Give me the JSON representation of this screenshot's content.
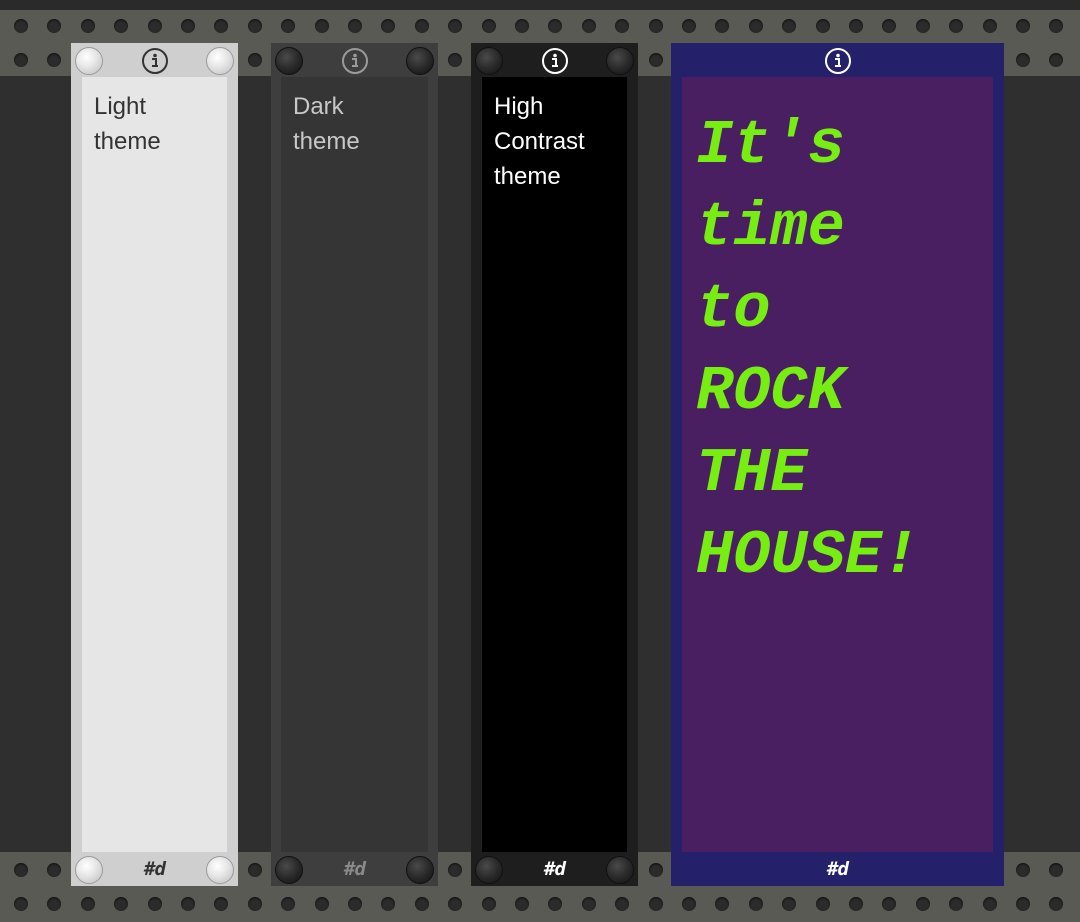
{
  "modules": {
    "light": {
      "label_line1": "Light",
      "label_line2": "theme",
      "logo": "#d",
      "icon": "info-icon",
      "colors": {
        "frame": "#cfcfcf",
        "panel": "#e6e6e6",
        "text": "#333333",
        "logo": "#333333",
        "icon": "#333333"
      }
    },
    "dark": {
      "label_line1": "Dark",
      "label_line2": "theme",
      "logo": "#d",
      "icon": "info-icon",
      "colors": {
        "frame": "#3e3e3e",
        "panel": "#353535",
        "text": "#c8c8c8",
        "logo": "#8a8a8a",
        "icon": "#9a9a9a"
      }
    },
    "high_contrast": {
      "label_line1": "High",
      "label_line2": "Contrast",
      "label_line3": "theme",
      "logo": "#d",
      "icon": "info-icon",
      "colors": {
        "frame": "#1e1e1e",
        "panel": "#000000",
        "text": "#ffffff",
        "logo": "#ffffff",
        "icon": "#ffffff"
      }
    },
    "custom": {
      "label_lines": [
        "It's",
        "time",
        "to",
        "ROCK",
        "THE",
        "HOUSE!"
      ],
      "logo": "#d",
      "icon": "info-icon",
      "colors": {
        "frame": "#25206a",
        "panel": "#4a1f62",
        "text": "#77ee11",
        "logo": "#ffffff",
        "icon": "#ffffff"
      }
    }
  }
}
